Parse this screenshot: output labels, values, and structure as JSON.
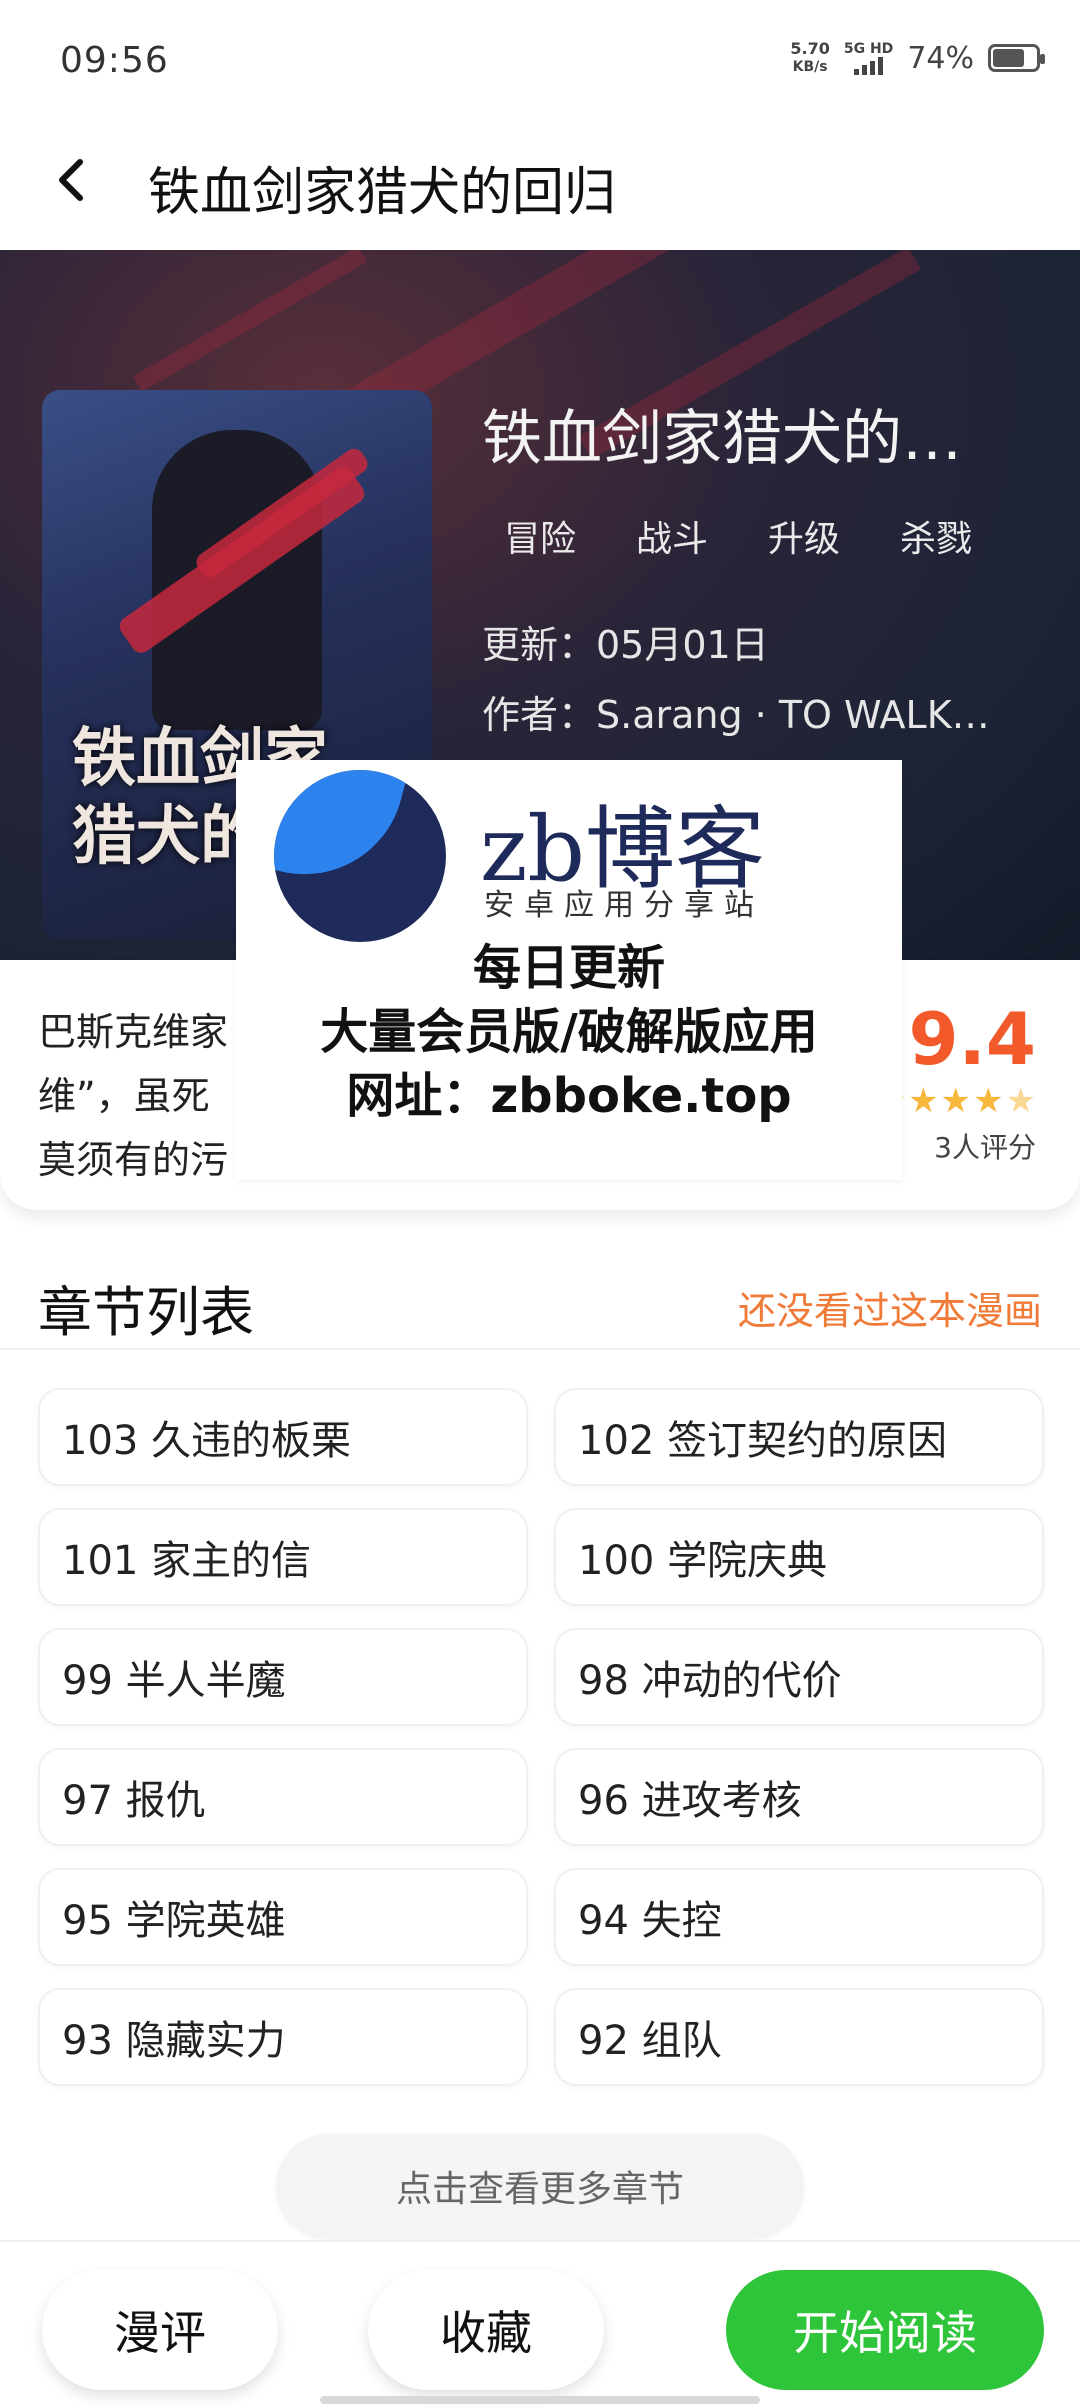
{
  "status_bar": {
    "time": "09:56",
    "speed_value": "5.70",
    "speed_unit": "KB/s",
    "network": "5G HD",
    "battery_text": "74%",
    "battery_level": 0.74
  },
  "header": {
    "title": "铁血剑家猎犬的回归"
  },
  "hero": {
    "title": "铁血剑家猎犬的…",
    "cover_caption": "铁血剑家\n猎犬的",
    "tags": [
      "冒险",
      "战斗",
      "升级",
      "杀戮"
    ],
    "update": "更新：05月01日",
    "author": "作者：S.arang · TO WALK…"
  },
  "description": {
    "text": "巴斯克维家\n维”，虽死\n莫须有的污"
  },
  "rating": {
    "score": "9.4",
    "stars": 4.5,
    "count": "3人评分"
  },
  "watermark": {
    "brand": "zb博客",
    "subtitle": "安卓应用分享站",
    "line1": "每日更新",
    "line2": "大量会员版/破解版应用",
    "line3": "网址：zbboke.top"
  },
  "chapters_section": {
    "title": "章节列表",
    "status_link": "还没看过这本漫画",
    "chapters": [
      "103 久违的板栗",
      "102 签订契约的原因",
      "101 家主的信",
      "100 学院庆典",
      "99 半人半魔",
      "98 冲动的代价",
      "97 报仇",
      "96 进攻考核",
      "95 学院英雄",
      "94 失控",
      "93 隐藏实力",
      "92 组队"
    ],
    "more_label": "点击查看更多章节"
  },
  "bottom_bar": {
    "comment_label": "漫评",
    "favorite_label": "收藏",
    "read_label": "开始阅读"
  },
  "colors": {
    "accent_green": "#2fc53b",
    "rating_orange": "#f25a2b",
    "link_orange": "#f07a38"
  }
}
